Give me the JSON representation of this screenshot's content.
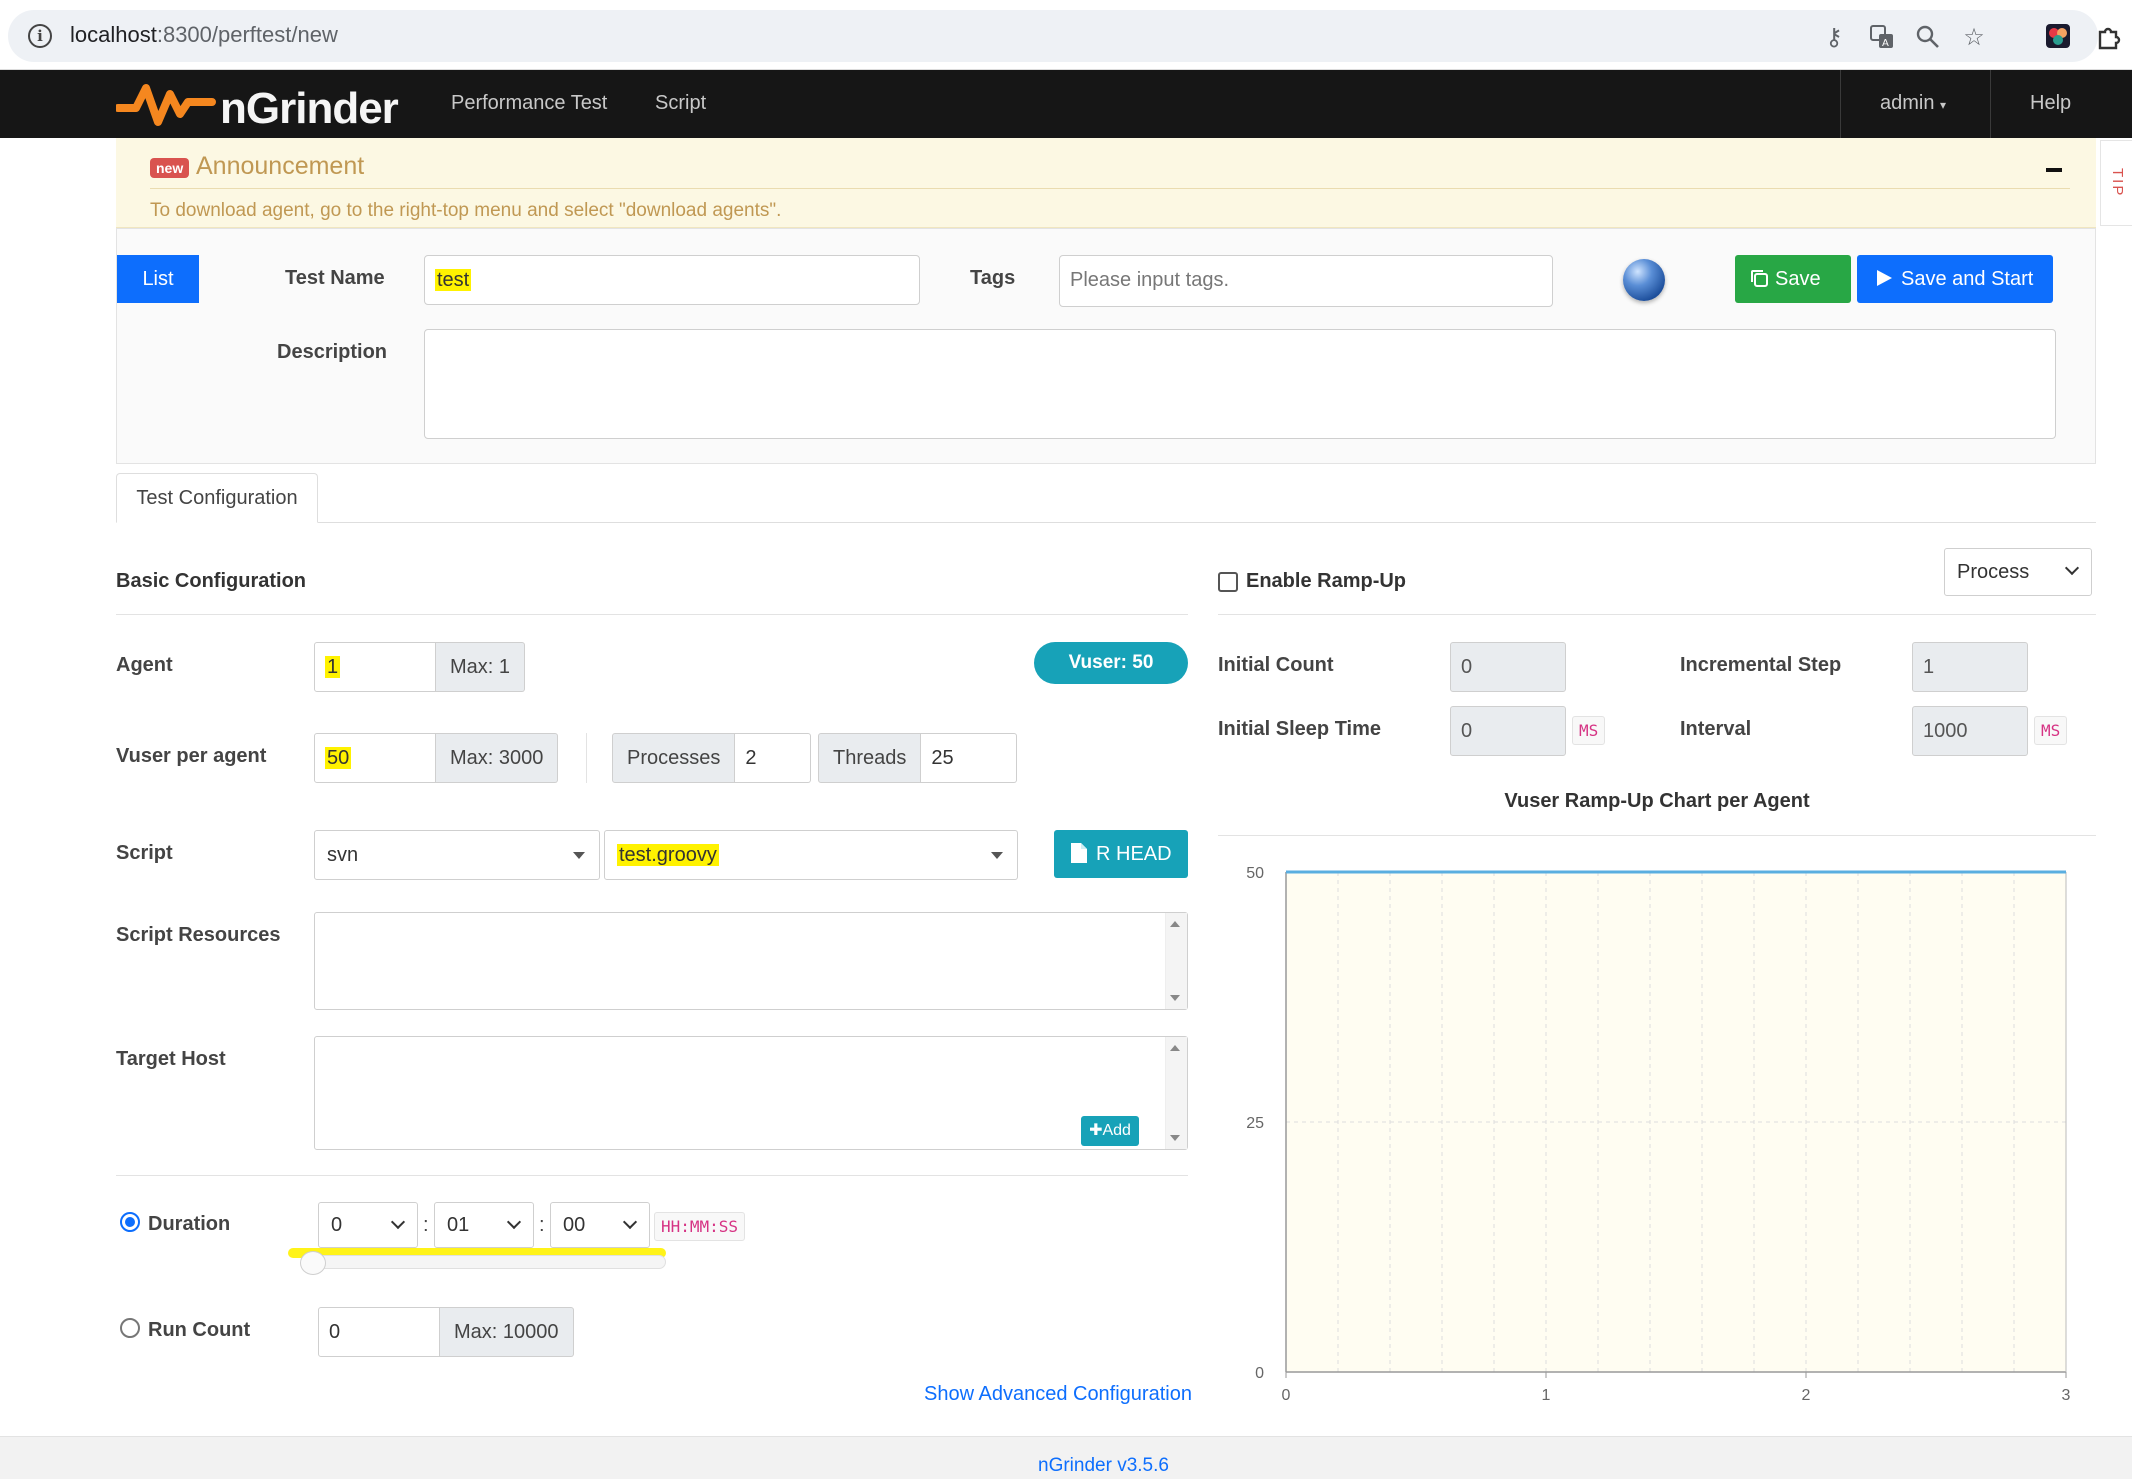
{
  "browser": {
    "url_host": "localhost",
    "url_path": ":8300/perftest/new"
  },
  "navbar": {
    "brand": "nGrinder",
    "links": [
      "Performance Test",
      "Script"
    ],
    "user": "admin",
    "help": "Help"
  },
  "announcement": {
    "badge": "new",
    "title": "Announcement",
    "text": "To download agent, go to the right-top menu and select \"download agents\".",
    "tip": "TIP"
  },
  "form": {
    "list_button": "List",
    "test_name_label": "Test Name",
    "test_name_value": "test",
    "tags_label": "Tags",
    "tags_placeholder": "Please input tags.",
    "save_button": "Save",
    "save_start_button": "Save and Start",
    "description_label": "Description"
  },
  "tabs": {
    "active": "Test Configuration"
  },
  "basic": {
    "title": "Basic Configuration",
    "agent_label": "Agent",
    "agent_value": "1",
    "agent_max": "Max: 1",
    "vuser_badge": "Vuser: 50",
    "vuser_label": "Vuser per agent",
    "vuser_value": "50",
    "vuser_max": "Max: 3000",
    "processes_label": "Processes",
    "processes_value": "2",
    "threads_label": "Threads",
    "threads_value": "25",
    "script_label": "Script",
    "script_repo": "svn",
    "script_file": "test.groovy",
    "head_button": "R HEAD",
    "resources_label": "Script Resources",
    "target_label": "Target Host",
    "add_button": "Add",
    "duration_label": "Duration",
    "duration_h": "0",
    "duration_m": "01",
    "duration_s": "00",
    "duration_format": "HH:MM:SS",
    "runcount_label": "Run Count",
    "runcount_value": "0",
    "runcount_max": "Max: 10000",
    "advanced_link": "Show Advanced Configuration"
  },
  "rampup": {
    "enable_label": "Enable Ramp-Up",
    "enabled": false,
    "type": "Process",
    "initial_count_label": "Initial Count",
    "initial_count": "0",
    "incremental_step_label": "Incremental Step",
    "incremental_step": "1",
    "initial_sleep_label": "Initial Sleep Time",
    "initial_sleep": "0",
    "interval_label": "Interval",
    "interval": "1000",
    "unit": "MS"
  },
  "chart_data": {
    "type": "line",
    "title": "Vuser Ramp-Up Chart per Agent",
    "xlabel": "",
    "ylabel": "",
    "x": [
      0,
      3
    ],
    "series": [
      {
        "values": [
          50,
          50
        ]
      }
    ],
    "xlim": [
      0,
      3
    ],
    "ylim": [
      0,
      50
    ],
    "xticks": [
      0,
      1,
      2,
      3
    ],
    "yticks": [
      0,
      25,
      50
    ],
    "grid": true,
    "line_color": "#5aaee0",
    "plot_background": "#fffdf2"
  },
  "footer": {
    "version": "nGrinder v3.5.6"
  }
}
